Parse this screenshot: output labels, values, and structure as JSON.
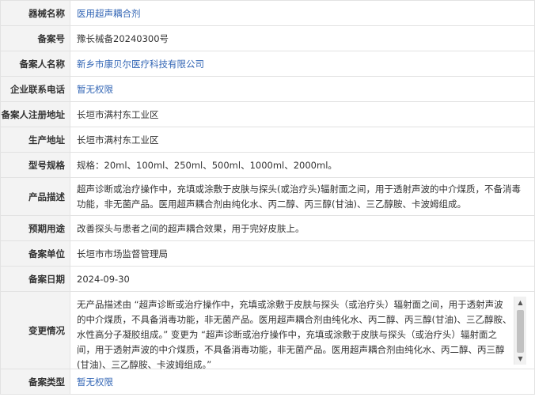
{
  "rows": [
    {
      "label": "器械名称",
      "value": "医用超声耦合剂",
      "style": "link"
    },
    {
      "label": "备案号",
      "value": "豫长械备20240300号",
      "style": "plain"
    },
    {
      "label": "备案人名称",
      "value": "新乡市康贝尔医疗科技有限公司",
      "style": "link"
    },
    {
      "label": "企业联系电话",
      "value": "暂无权限",
      "style": "link"
    },
    {
      "label": "备案人注册地址",
      "value": "长垣市满村东工业区",
      "style": "plain"
    },
    {
      "label": "生产地址",
      "value": "长垣市满村东工业区",
      "style": "plain"
    },
    {
      "label": "型号规格",
      "value": "规格：20ml、100ml、250ml、500ml、1000ml、2000ml。",
      "style": "plain"
    },
    {
      "label": "产品描述",
      "value": "超声诊断或治疗操作中，充填或涂敷于皮肤与探头(或治疗头)辐射面之间，用于透射声波的中介煤质，不备消毒功能，非无菌产品。医用超声耦合剂由纯化水、丙二醇、丙三醇(甘油)、三乙醇胺、卡波姆组成。",
      "style": "plain"
    },
    {
      "label": "预期用途",
      "value": "改善探头与患者之间的超声耦合效果，用于完好皮肤上。",
      "style": "plain"
    },
    {
      "label": "备案单位",
      "value": "长垣市市场监督管理局",
      "style": "plain"
    },
    {
      "label": "备案日期",
      "value": "2024-09-30",
      "style": "plain"
    },
    {
      "label": "变更情况",
      "value": "无产品描述由 “超声诊断或治疗操作中，充填或涂敷于皮肤与探头（或治疗头）辐射面之间，用于透射声波的中介煤质，不具备消毒功能，非无菌产品。医用超声耦合剂由纯化水、丙二醇、丙三醇(甘油)、三乙醇胺、水性高分子凝胶组成。” 变更为 “超声诊断或治疗操作中，充填或涂敷于皮肤与探头（或治疗头）辐射面之间，用于透射声波的中介煤质，不具备消毒功能，非无菌产品。医用超声耦合剂由纯化水、丙二醇、丙三醇(甘油)、三乙醇胺、卡波姆组成。”",
      "style": "plain"
    },
    {
      "label": "备案类型",
      "value": "暂无权限",
      "style": "link"
    }
  ]
}
